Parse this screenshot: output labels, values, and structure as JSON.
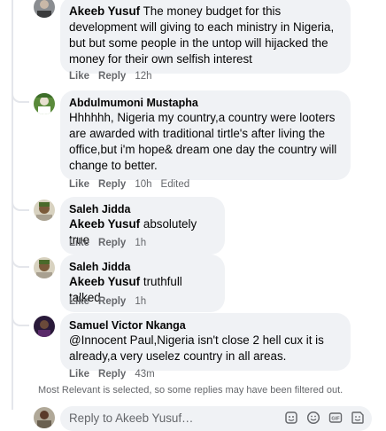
{
  "comments": [
    {
      "author": "Akeeb Yusuf",
      "text": "The money budget for this development will giving to each ministry in Nigeria, but but some people in the untop will hijacked the money for their own selfish interest",
      "like": "Like",
      "reply": "Reply",
      "time": "12h"
    },
    {
      "author": "Abdulmumoni Mustapha",
      "text": "Hhhhhh, Nigeria my country,a country were looters are awarded with traditional tirtle's after living the office,but i'm hope& dream one day the country will change to better.",
      "like": "Like",
      "reply": "Reply",
      "time": "10h",
      "edited": "Edited"
    },
    {
      "author": "Saleh Jidda",
      "mention": "Akeeb Yusuf",
      "text": "absolutely true",
      "like": "Like",
      "reply": "Reply",
      "time": "1h"
    },
    {
      "author": "Saleh Jidda",
      "mention": "Akeeb Yusuf",
      "text": "truthfull talked",
      "like": "Like",
      "reply": "Reply",
      "time": "1h"
    },
    {
      "author": "Samuel Victor Nkanga",
      "text": "@Innocent Paul,Nigeria isn't close 2 hell cux it is already,a very uselez country in all areas.",
      "like": "Like",
      "reply": "Reply",
      "time": "43m"
    }
  ],
  "filter_note": "Most Relevant is selected, so some replies may have been filtered out.",
  "reply_box": {
    "placeholder": "Reply to Akeeb Yusuf…",
    "icons": [
      "sticker-icon",
      "emoji-icon",
      "gif-icon",
      "sticker-alt-icon"
    ]
  }
}
